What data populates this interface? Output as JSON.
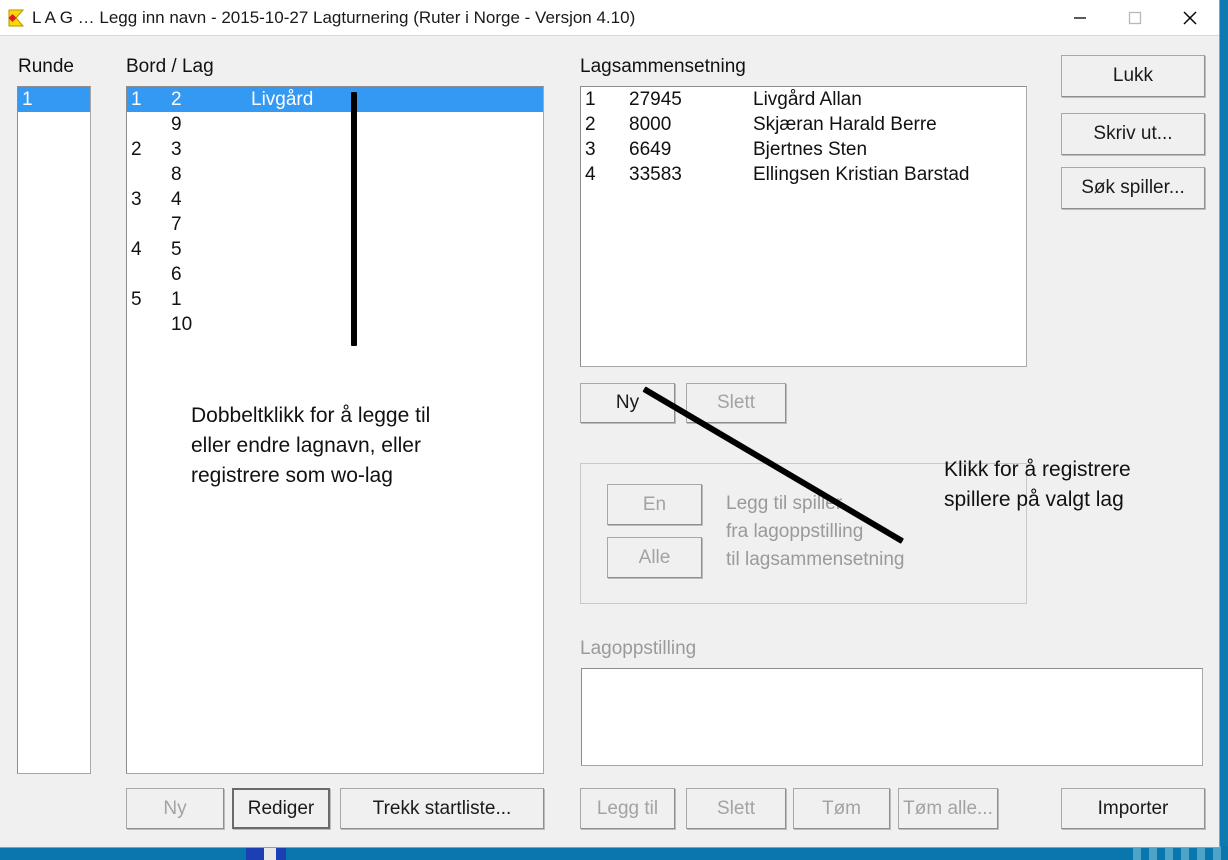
{
  "window": {
    "title": "L A G … Legg inn navn - 2015-10-27  Lagturnering  (Ruter i Norge - Versjon 4.10)",
    "icon": "sigma-diamond-icon",
    "controls": {
      "minimize": "minimize-icon",
      "maximize": "maximize-icon",
      "close": "close-icon"
    }
  },
  "runde": {
    "label": "Runde",
    "items": [
      {
        "text": "1",
        "selected": true
      }
    ]
  },
  "bordlag": {
    "label": "Bord / Lag",
    "rows": [
      {
        "bord": "1",
        "lag": "2",
        "navn": "Livgård",
        "selected": true
      },
      {
        "bord": "",
        "lag": "9",
        "navn": "",
        "selected": false
      },
      {
        "bord": "2",
        "lag": "3",
        "navn": "",
        "selected": false
      },
      {
        "bord": "",
        "lag": "8",
        "navn": "",
        "selected": false
      },
      {
        "bord": "3",
        "lag": "4",
        "navn": "",
        "selected": false
      },
      {
        "bord": "",
        "lag": "7",
        "navn": "",
        "selected": false
      },
      {
        "bord": "4",
        "lag": "5",
        "navn": "",
        "selected": false
      },
      {
        "bord": "",
        "lag": "6",
        "navn": "",
        "selected": false
      },
      {
        "bord": "5",
        "lag": "1",
        "navn": "",
        "selected": false
      },
      {
        "bord": "",
        "lag": "10",
        "navn": "",
        "selected": false
      }
    ],
    "annotation": "Dobbeltklikk for å legge til\neller endre lagnavn, eller\nregistrere som wo-lag"
  },
  "lagsammensetning": {
    "label": "Lagsammensetning",
    "rows": [
      {
        "nr": "1",
        "id": "27945",
        "navn": "Livgård Allan"
      },
      {
        "nr": "2",
        "id": "8000",
        "navn": "Skjæran Harald Berre"
      },
      {
        "nr": "3",
        "id": "6649",
        "navn": "Bjertnes Sten"
      },
      {
        "nr": "4",
        "id": "33583",
        "navn": "Ellingsen Kristian Barstad"
      }
    ],
    "ny_label": "Ny",
    "slett_label": "Slett"
  },
  "addgroup": {
    "en_label": "En",
    "alle_label": "Alle",
    "helper_text": "Legg til spiller\nfra lagoppstilling\ntil lagsammensetning",
    "annotation": "Klikk for å registrere\nspillere på valgt lag"
  },
  "lagoppstilling": {
    "label": "Lagoppstilling",
    "rows": []
  },
  "bottom_left_buttons": [
    {
      "label": "Ny",
      "disabled": true,
      "focused": false
    },
    {
      "label": "Rediger",
      "disabled": false,
      "focused": true
    },
    {
      "label": "Trekk startliste...",
      "disabled": false,
      "focused": false
    }
  ],
  "bottom_right_buttons": [
    {
      "label": "Legg til",
      "disabled": true
    },
    {
      "label": "Slett",
      "disabled": true
    },
    {
      "label": "Tøm",
      "disabled": true
    },
    {
      "label": "Tøm alle...",
      "disabled": true
    }
  ],
  "side_buttons": [
    {
      "label": "Lukk"
    },
    {
      "label": "Skriv ut..."
    },
    {
      "label": "Søk spiller..."
    }
  ],
  "importer_button": {
    "label": "Importer"
  },
  "colors": {
    "selection_blue": "#3399f3",
    "window_bg": "#f0f0f0",
    "desktop_blue": "#0d7ab2",
    "disabled_text": "#a3a3a3",
    "icon_yellow": "#ffd800",
    "icon_red": "#e01b24"
  }
}
